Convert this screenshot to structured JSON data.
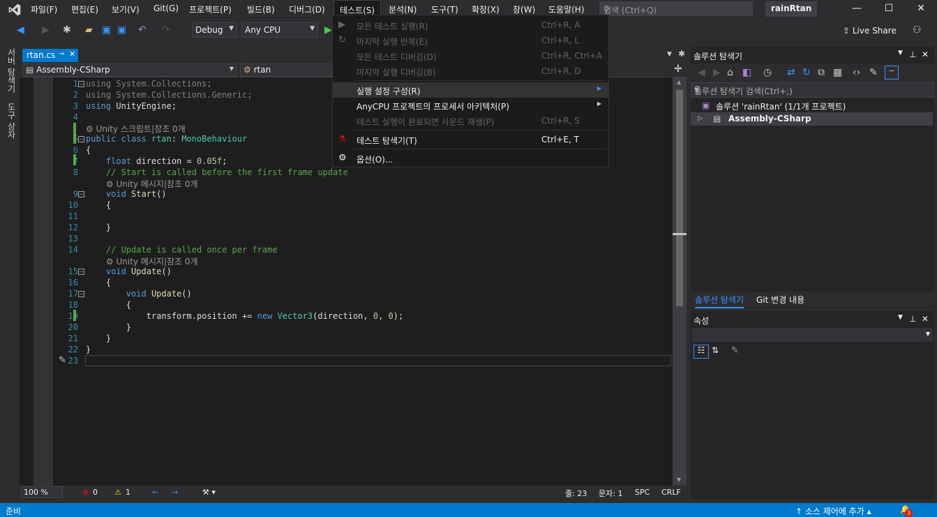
{
  "menubar": {
    "items": [
      "파일(F)",
      "편집(E)",
      "보기(V)",
      "Git(G)",
      "프로젝트(P)",
      "빌드(B)",
      "디버그(D)",
      "테스트(S)",
      "분석(N)",
      "도구(T)",
      "확장(X)",
      "창(W)",
      "도움말(H)"
    ],
    "search_placeholder": "검색 (Ctrl+Q)",
    "project_name": "rainRtan"
  },
  "toolbar": {
    "config": "Debug",
    "platform": "Any CPU",
    "live_share": "Live Share"
  },
  "left_tabs": [
    "서버 탐색기",
    "도구 상자"
  ],
  "editor": {
    "tab_name": "rtan.cs",
    "nav_project": "Assembly-CSharp",
    "nav_class": "rtan",
    "line_numbers": [
      "1",
      "2",
      "3",
      "4",
      "5",
      "6",
      "7",
      "8",
      "9",
      "10",
      "11",
      "12",
      "13",
      "14",
      "15",
      "16",
      "17",
      "18",
      "19",
      "20",
      "21",
      "22",
      "23"
    ],
    "hint_script": "Unity 스크립트|참조 0개",
    "hint_message": "Unity 메시지|참조 0개",
    "zoom": "100 %",
    "errors": "0",
    "warnings": "1",
    "line_label": "줄: 23",
    "char_label": "문자: 1",
    "spc": "SPC",
    "crlf": "CRLF"
  },
  "test_menu": {
    "items": [
      {
        "label": "모든 테스트 실행(R)",
        "shortcut": "Ctrl+R, A",
        "enabled": false
      },
      {
        "label": "마지막 실행 반복(E)",
        "shortcut": "Ctrl+R, L",
        "enabled": false
      },
      {
        "label": "모든 테스트 디버깅(D)",
        "shortcut": "Ctrl+R, Ctrl+A",
        "enabled": false
      },
      {
        "label": "마지막 실행 디버깅(B)",
        "shortcut": "Ctrl+R, D",
        "enabled": false
      },
      {
        "label": "실행 설정 구성(R)",
        "shortcut": "",
        "enabled": true
      },
      {
        "label": "AnyCPU 프로젝트의 프로세서 아키텍처(P)",
        "shortcut": "",
        "enabled": true
      },
      {
        "label": "테스트 실행이 완료되면 사운드 재생(P)",
        "shortcut": "Ctrl+R, S",
        "enabled": false
      },
      {
        "label": "테스트 탐색기(T)",
        "shortcut": "Ctrl+E, T",
        "enabled": true
      },
      {
        "label": "옵션(O)...",
        "shortcut": "",
        "enabled": true
      }
    ]
  },
  "solution_explorer": {
    "title": "솔루션 탐색기",
    "search_placeholder": "솔루션 탐색기 검색(Ctrl+;)",
    "solution_label": "솔루션 'rainRtan' (1/1개 프로젝트)",
    "project_label": "Assembly-CSharp",
    "tab_active": "솔루션 탐색기",
    "tab_other": "Git 변경 내용"
  },
  "properties": {
    "title": "속성"
  },
  "statusbar": {
    "ready": "준비",
    "source_control": "소스 제어에 추가",
    "notifications": "3"
  },
  "colors": {
    "accent": "#007acc",
    "background": "#2d2d30",
    "editor_bg": "#1e1e1e",
    "keyword": "#569cd6",
    "class": "#4ec9b0",
    "comment": "#57a64a"
  }
}
